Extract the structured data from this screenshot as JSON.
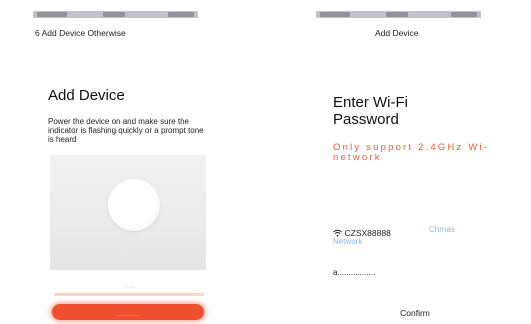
{
  "left": {
    "caption": "6 Add Device Otherwise",
    "title": "Add Device",
    "instruction": "Power the device on and make sure the indicator is flashing quickly or a prompt tone is heard",
    "checkbox_label": "····",
    "next_label": "············"
  },
  "right": {
    "caption": "Add Device",
    "title": "Enter Wi-Fi Password",
    "note": "Only support 2.4GHz Wi-network",
    "wifi_icon": "wifi-icon",
    "ssid": "CZSX88888",
    "change_network": "Chrnas Network",
    "password": "a.................",
    "confirm": "Confirm"
  },
  "colors": {
    "accent": "#ee4f2e",
    "note": "#ee5a3c",
    "link": "#8fb6e6"
  }
}
